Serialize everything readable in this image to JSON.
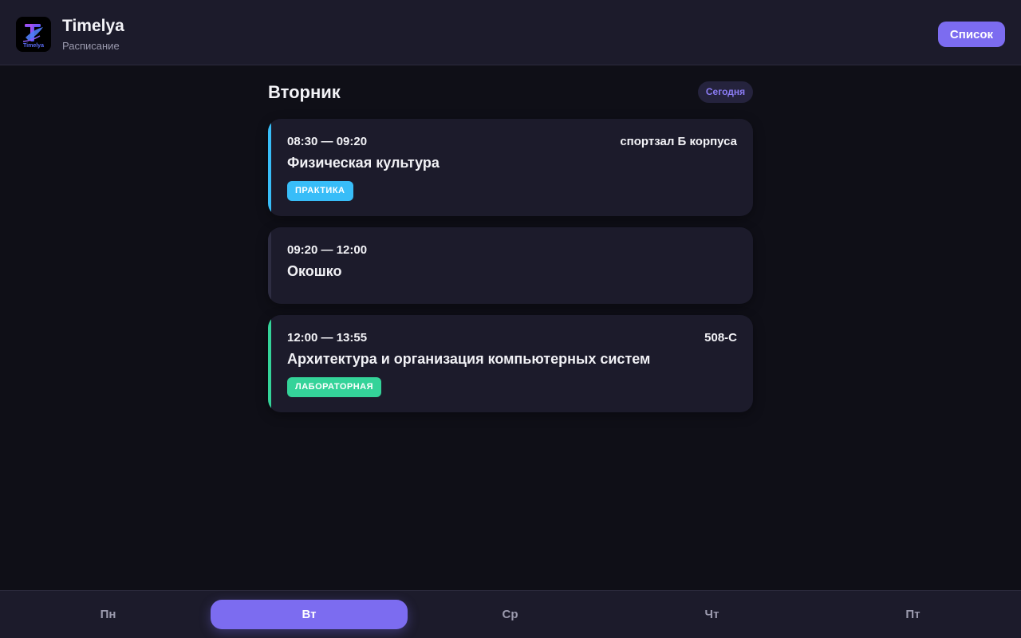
{
  "header": {
    "title": "Timelya",
    "subtitle": "Расписание",
    "logo_icon": "timelya-logo",
    "logo_text": "Timelya",
    "list_button_label": "Список"
  },
  "day": {
    "title": "Вторник",
    "today_badge": "Сегодня"
  },
  "lessons": [
    {
      "time": "08:30 — 09:20",
      "room": "спортзал Б корпуса",
      "subject": "Физическая культура",
      "tag": "ПРАКТИКА",
      "accent_color": "#38bdf8"
    },
    {
      "time": "09:20 — 12:00",
      "room": "",
      "subject": "Окошко",
      "tag": "",
      "accent_color": "#2e2d42"
    },
    {
      "time": "12:00 — 13:55",
      "room": "508-С",
      "subject": "Архитектура и организация компьютерных систем",
      "tag": "ЛАБОРАТОРНАЯ",
      "accent_color": "#34d399"
    }
  ],
  "nav": {
    "items": [
      "Пн",
      "Вт",
      "Ср",
      "Чт",
      "Пт"
    ],
    "active": "Вт"
  },
  "colors": {
    "background": "#0f0f17",
    "surface": "#1c1b2b",
    "accent": "#7c6cf0",
    "practice": "#38bdf8",
    "lab": "#34d399"
  }
}
